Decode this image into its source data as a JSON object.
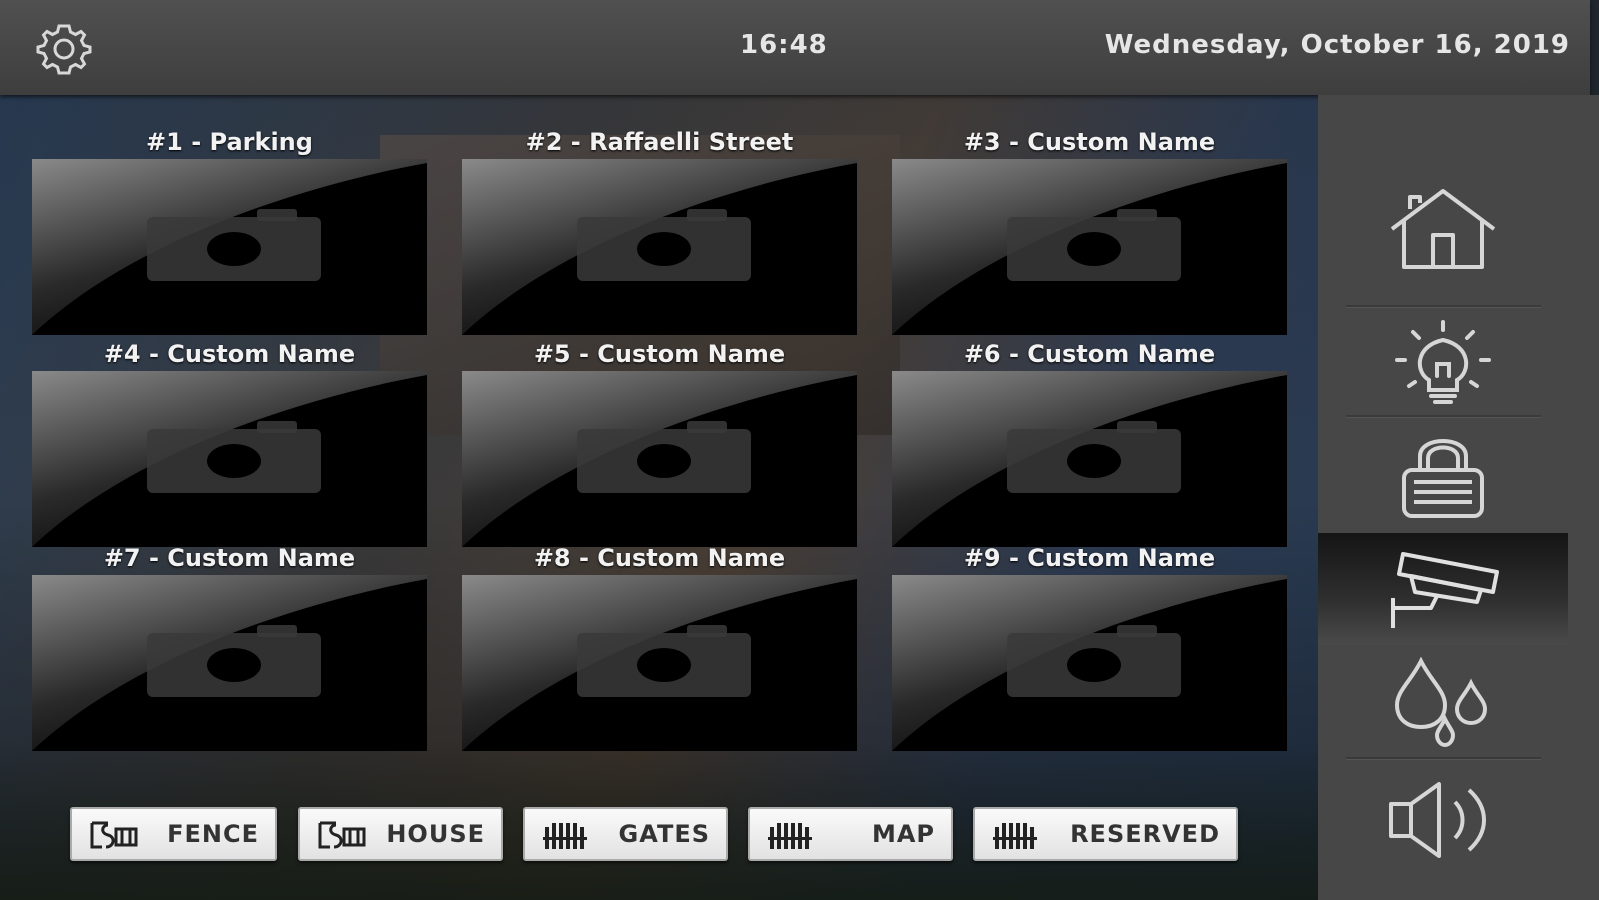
{
  "header": {
    "time": "16:48",
    "date": "Wednesday, October 16, 2019"
  },
  "cameras": [
    {
      "title": "#1 - Parking"
    },
    {
      "title": "#2 - Raffaelli Street"
    },
    {
      "title": "#3 - Custom Name"
    },
    {
      "title": "#4 - Custom Name"
    },
    {
      "title": "#5 - Custom Name"
    },
    {
      "title": "#6 - Custom Name"
    },
    {
      "title": "#7 - Custom Name"
    },
    {
      "title": "#8 - Custom Name"
    },
    {
      "title": "#9 - Custom Name"
    }
  ],
  "bottom_buttons": [
    {
      "label": "FENCE",
      "icon": "fence-icon"
    },
    {
      "label": "HOUSE",
      "icon": "fence-icon"
    },
    {
      "label": "GATES",
      "icon": "gate-icon"
    },
    {
      "label": "MAP",
      "icon": "gate-icon"
    },
    {
      "label": "RESERVED",
      "icon": "gate-icon"
    }
  ],
  "sidebar": {
    "items": [
      "home-icon",
      "lightbulb-icon",
      "lock-icon",
      "cctv-camera-icon",
      "water-drops-icon",
      "speaker-icon"
    ],
    "active": "cctv-camera-icon"
  },
  "colors": {
    "topbar": "#474747",
    "sidebar": "#474747",
    "accent_text": "#e6e6e6"
  }
}
